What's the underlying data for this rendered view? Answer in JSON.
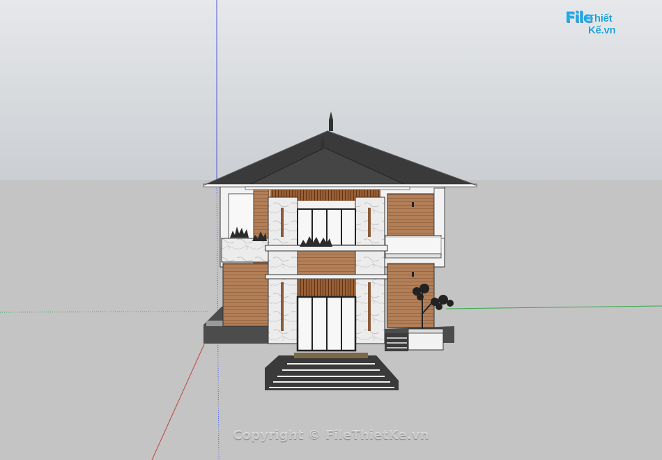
{
  "watermark": {
    "logo_prefix": "File",
    "logo_suffix": "Thiết Kế.vn",
    "copyright": "Copyright © FileThietKe.vn"
  },
  "colors": {
    "sky_top": "#e4e6e9",
    "sky_bottom": "#cdd0d4",
    "ground": "#c4c4c4",
    "roof": "#3d3d3d",
    "wood": "#b17e58",
    "marble": "#e8e8e8",
    "base": "#4a4a4a",
    "axis_red": "#c0433b",
    "axis_green": "#3aa84e",
    "axis_blue": "#4a5bc9",
    "logo_blue": "#1da9e6"
  }
}
